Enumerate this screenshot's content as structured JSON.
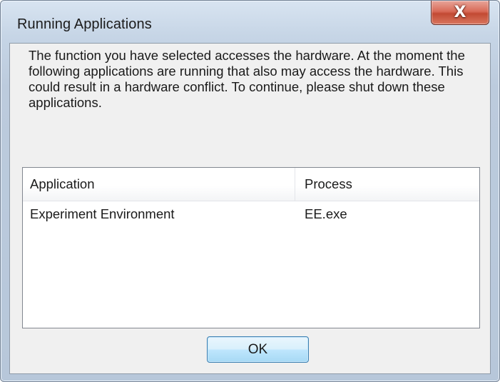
{
  "window": {
    "title": "Running Applications",
    "close_icon_glyph": "X"
  },
  "message": {
    "text": "The function you have selected accesses the hardware. At the moment the following applications are running that also may access the hardware. This could result in a hardware conflict. To continue, please shut down these applications."
  },
  "list": {
    "columns": [
      "Application",
      "Process"
    ],
    "rows": [
      {
        "application": "Experiment Environment",
        "process": "EE.exe"
      }
    ]
  },
  "buttons": {
    "ok_label": "OK"
  },
  "colors": {
    "close_button": "#c24a33",
    "ok_button_border": "#3c7fb1",
    "client_background": "#f0f0f0"
  }
}
